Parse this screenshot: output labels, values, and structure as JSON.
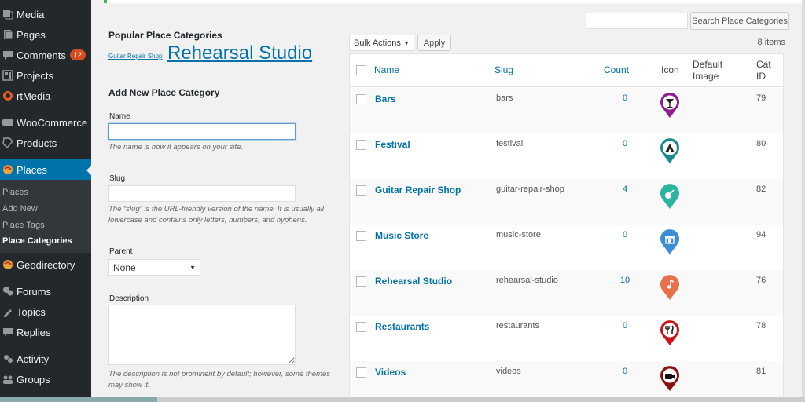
{
  "sidebar": {
    "items": [
      {
        "label": "Media",
        "icon": "media-icon"
      },
      {
        "label": "Pages",
        "icon": "pages-icon"
      },
      {
        "label": "Comments",
        "icon": "comments-icon",
        "badge": "12"
      },
      {
        "label": "Projects",
        "icon": "projects-icon"
      },
      {
        "label": "rtMedia",
        "icon": "rtmedia-icon"
      },
      {
        "label": "WooCommerce",
        "icon": "woocommerce-icon"
      },
      {
        "label": "Products",
        "icon": "products-icon"
      },
      {
        "label": "Places",
        "icon": "places-icon"
      },
      {
        "label": "Geodirectory",
        "icon": "geodirectory-icon"
      },
      {
        "label": "Forums",
        "icon": "forums-icon"
      },
      {
        "label": "Topics",
        "icon": "topics-icon"
      },
      {
        "label": "Replies",
        "icon": "replies-icon"
      },
      {
        "label": "Activity",
        "icon": "activity-icon"
      },
      {
        "label": "Groups",
        "icon": "groups-icon"
      }
    ],
    "submenu": [
      "Places",
      "Add New",
      "Place Tags",
      "Place Categories"
    ]
  },
  "popular": {
    "title": "Popular Place Categories",
    "tags": [
      "Guitar Repair Shop",
      "Rehearsal Studio"
    ]
  },
  "form": {
    "title": "Add New Place Category",
    "name_label": "Name",
    "name_value": "",
    "name_desc": "The name is how it appears on your site.",
    "slug_label": "Slug",
    "slug_value": "",
    "slug_desc": "The “slug” is the URL-friendly version of the name. It is usually all lowercase and contains only letters, numbers, and hyphens.",
    "parent_label": "Parent",
    "parent_value": "None",
    "description_label": "Description",
    "description_value": "",
    "description_desc": "The description is not prominent by default; however, some themes may show it."
  },
  "search": {
    "value": "",
    "button": "Search Place Categories"
  },
  "bulk": {
    "selected": "Bulk Actions",
    "apply": "Apply"
  },
  "item_count": "8 items",
  "table": {
    "headers": {
      "name": "Name",
      "slug": "Slug",
      "count": "Count",
      "icon": "Icon",
      "default_image": "Default Image",
      "cat_id": "Cat ID"
    },
    "rows": [
      {
        "name": "Bars",
        "slug": "bars",
        "count": "0",
        "icon": "cocktail-icon",
        "color": "#8e1d8e",
        "id": "79"
      },
      {
        "name": "Festival",
        "slug": "festival",
        "count": "0",
        "icon": "tent-icon",
        "color": "#1a8a8a",
        "id": "80"
      },
      {
        "name": "Guitar Repair Shop",
        "slug": "guitar-repair-shop",
        "count": "4",
        "icon": "guitar-icon",
        "color": "#2bb5a0",
        "id": "82"
      },
      {
        "name": "Music Store",
        "slug": "music-store",
        "count": "0",
        "icon": "store-icon",
        "color": "#3b8fd6",
        "id": "94"
      },
      {
        "name": "Rehearsal Studio",
        "slug": "rehearsal-studio",
        "count": "10",
        "icon": "music-note-icon",
        "color": "#e8704a",
        "id": "76"
      },
      {
        "name": "Restaurants",
        "slug": "restaurants",
        "count": "0",
        "icon": "utensils-icon",
        "color": "#d0121a",
        "id": "78"
      },
      {
        "name": "Videos",
        "slug": "videos",
        "count": "0",
        "icon": "video-camera-icon",
        "color": "#8b1010",
        "id": "81"
      }
    ]
  }
}
